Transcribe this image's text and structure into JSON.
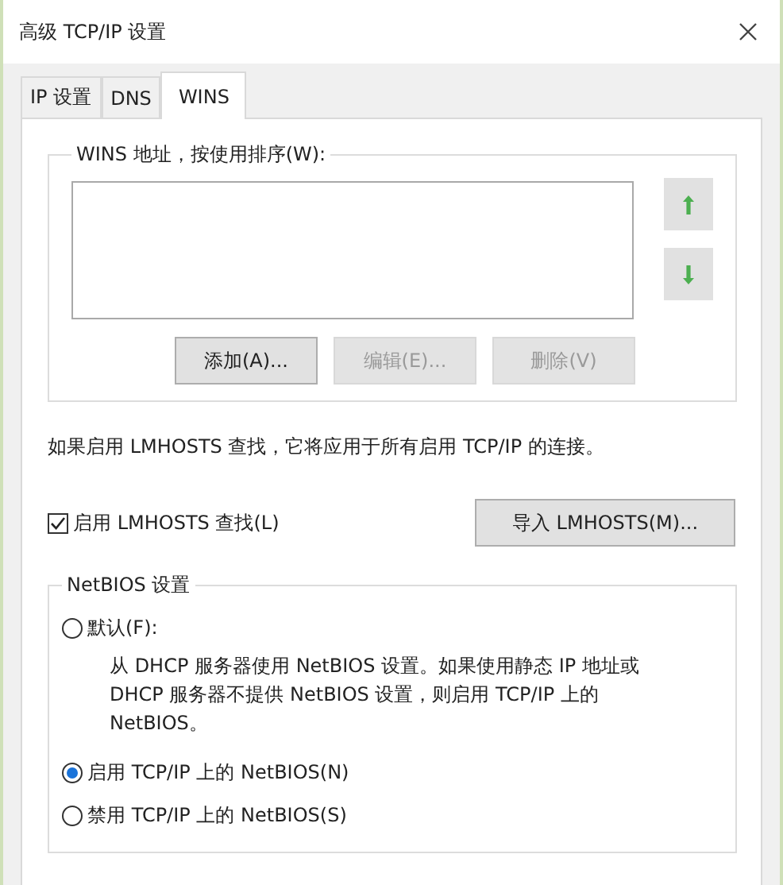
{
  "window": {
    "title": "高级 TCP/IP 设置"
  },
  "tabs": [
    {
      "label": "IP 设置",
      "selected": false
    },
    {
      "label": "DNS",
      "selected": false
    },
    {
      "label": "WINS",
      "selected": true
    }
  ],
  "wins_group": {
    "label": "WINS 地址，按使用排序(W):",
    "move_buttons": [
      {
        "kind": "up",
        "disabled": true
      },
      {
        "kind": "down",
        "disabled": true
      }
    ],
    "buttons": [
      {
        "label": "添加(A)...",
        "disabled": false
      },
      {
        "label": "编辑(E)...",
        "disabled": true
      },
      {
        "label": "删除(V)",
        "disabled": true
      }
    ]
  },
  "lmhosts_note": "如果启用 LMHOSTS 查找，它将应用于所有启用 TCP/IP 的连接。",
  "lmhosts_checkbox": {
    "label": "启用 LMHOSTS 查找(L)",
    "checked": true
  },
  "import_button": {
    "label": "导入 LMHOSTS(M)..."
  },
  "netbios_group": {
    "label": "NetBIOS 设置",
    "options": [
      {
        "label": "默认(F):",
        "description": "从 DHCP 服务器使用 NetBIOS 设置。如果使用静态 IP 地址或 DHCP 服务器不提供 NetBIOS 设置，则启用 TCP/IP 上的 NetBIOS。",
        "selected": false
      },
      {
        "label": "启用 TCP/IP 上的 NetBIOS(N)",
        "selected": true
      },
      {
        "label": "禁用 TCP/IP 上的 NetBIOS(S)",
        "selected": false
      }
    ]
  }
}
